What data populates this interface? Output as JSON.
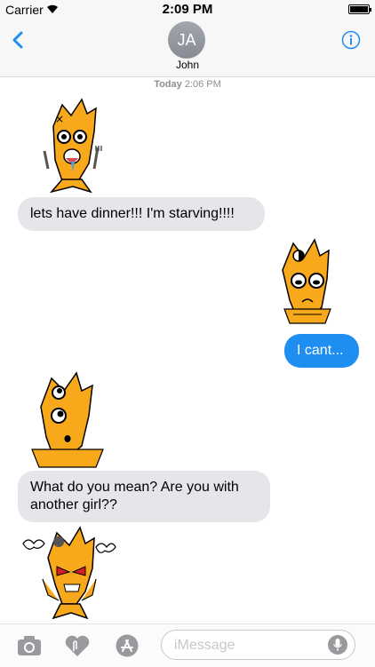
{
  "status_bar": {
    "carrier": "Carrier",
    "time": "2:09 PM"
  },
  "nav": {
    "avatar_initials": "JA",
    "contact_name": "John"
  },
  "thread": {
    "date_label": "Today",
    "time_label": "2:06 PM",
    "messages": [
      {
        "type": "sticker",
        "from": "them",
        "description": "hungry fish with fork and knife"
      },
      {
        "type": "text",
        "from": "them",
        "text": "lets have dinner!!! I'm starving!!!!"
      },
      {
        "type": "sticker",
        "from": "me",
        "description": "sad fish with arms crossed"
      },
      {
        "type": "text",
        "from": "me",
        "text": "I cant..."
      },
      {
        "type": "sticker",
        "from": "them",
        "description": "surprised fish"
      },
      {
        "type": "text",
        "from": "them",
        "text": "What do you mean? Are you with another girl??"
      },
      {
        "type": "sticker",
        "from": "them",
        "description": "angry fish"
      }
    ]
  },
  "composer": {
    "placeholder": "iMessage"
  },
  "icons": {
    "back": "chevron-left-icon",
    "info": "info-icon",
    "camera": "camera-icon",
    "digital_touch": "heart-touch-icon",
    "app_store": "app-store-icon",
    "mic": "microphone-icon"
  },
  "colors": {
    "accent": "#1f8ef1",
    "incoming_bubble": "#e5e5ea",
    "sticker_fish": "#f7a81b"
  }
}
